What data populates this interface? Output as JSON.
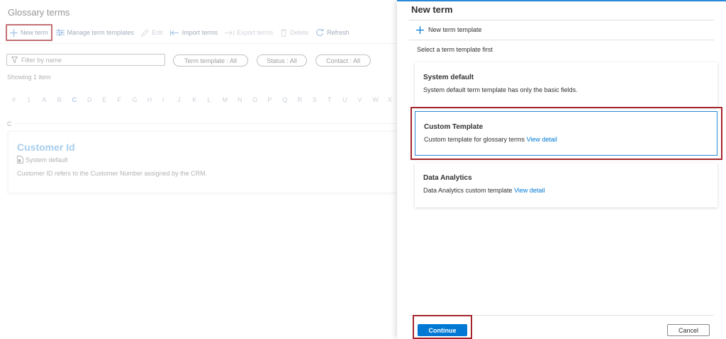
{
  "page": {
    "title": "Glossary terms"
  },
  "toolbar": {
    "new_term": "New term",
    "manage_templates": "Manage term templates",
    "edit": "Edit",
    "import_terms": "Import terms",
    "export_terms": "Export terms",
    "delete": "Delete",
    "refresh": "Refresh"
  },
  "filters": {
    "search_placeholder": "Filter by name",
    "term_template": "Term template : All",
    "status": "Status : All",
    "contact": "Contact : All"
  },
  "results": {
    "showing": "Showing 1 item",
    "alphabet": [
      "#",
      "1",
      "A",
      "B",
      "C",
      "D",
      "E",
      "F",
      "G",
      "H",
      "I",
      "J",
      "K",
      "L",
      "M",
      "N",
      "O",
      "P",
      "Q",
      "R",
      "S",
      "T",
      "U",
      "V",
      "W",
      "X"
    ],
    "active_letter": "C",
    "group_letter": "C",
    "term": {
      "name": "Customer Id",
      "template": "System default",
      "description": "Customer ID refers to the Customer Number assigned by the CRM."
    }
  },
  "panel": {
    "title": "New term",
    "new_template": "New term template",
    "hint": "Select a term template first",
    "templates": [
      {
        "title": "System default",
        "description": "System default term template has only the basic fields.",
        "link": "",
        "selected": false
      },
      {
        "title": "Custom Template",
        "description": "Custom template for glossary terms",
        "link": "View detail",
        "selected": true
      },
      {
        "title": "Data Analytics",
        "description": "Data Analytics custom template",
        "link": "View detail",
        "selected": false
      }
    ],
    "continue": "Continue",
    "cancel": "Cancel"
  },
  "colors": {
    "accent": "#0078d4",
    "highlight": "#a4262c"
  }
}
